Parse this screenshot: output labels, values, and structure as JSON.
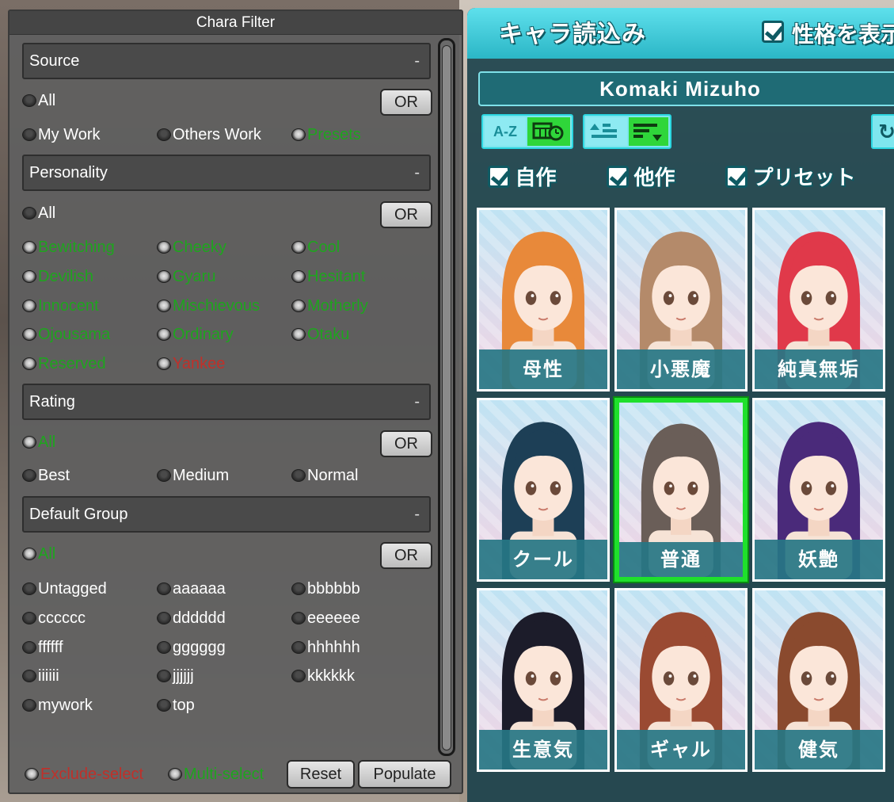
{
  "filter": {
    "title": "Chara Filter",
    "collapse_symbol": "-",
    "or_label": "OR",
    "source": {
      "header": "Source",
      "all": "All",
      "options": [
        {
          "label": "My Work",
          "selected": false,
          "color": "white"
        },
        {
          "label": "Others Work",
          "selected": false,
          "color": "white"
        },
        {
          "label": "Presets",
          "selected": true,
          "color": "green"
        }
      ]
    },
    "personality": {
      "header": "Personality",
      "all": "All",
      "options": [
        {
          "label": "Bewitching",
          "selected": true,
          "color": "green"
        },
        {
          "label": "Cheeky",
          "selected": true,
          "color": "green"
        },
        {
          "label": "Cool",
          "selected": true,
          "color": "green"
        },
        {
          "label": "Devilish",
          "selected": true,
          "color": "green"
        },
        {
          "label": "Gyaru",
          "selected": true,
          "color": "green"
        },
        {
          "label": "Hesitant",
          "selected": true,
          "color": "green"
        },
        {
          "label": "Innocent",
          "selected": true,
          "color": "green"
        },
        {
          "label": "Mischievous",
          "selected": true,
          "color": "green"
        },
        {
          "label": "Motherly",
          "selected": true,
          "color": "green"
        },
        {
          "label": "Ojousama",
          "selected": true,
          "color": "green"
        },
        {
          "label": "Ordinary",
          "selected": true,
          "color": "green"
        },
        {
          "label": "Otaku",
          "selected": true,
          "color": "green"
        },
        {
          "label": "Reserved",
          "selected": true,
          "color": "green"
        },
        {
          "label": "Yankee",
          "selected": true,
          "color": "red"
        }
      ]
    },
    "rating": {
      "header": "Rating",
      "all": "All",
      "options": [
        {
          "label": "Best",
          "selected": false,
          "color": "white"
        },
        {
          "label": "Medium",
          "selected": false,
          "color": "white"
        },
        {
          "label": "Normal",
          "selected": false,
          "color": "white"
        }
      ]
    },
    "default_group": {
      "header": "Default Group",
      "all": "All",
      "options": [
        {
          "label": "Untagged"
        },
        {
          "label": "aaaaaa"
        },
        {
          "label": "bbbbbb"
        },
        {
          "label": "cccccc"
        },
        {
          "label": "dddddd"
        },
        {
          "label": "eeeeee"
        },
        {
          "label": "ffffff"
        },
        {
          "label": "gggggg"
        },
        {
          "label": "hhhhhh"
        },
        {
          "label": "iiiiii"
        },
        {
          "label": "jjjjjj"
        },
        {
          "label": "kkkkkk"
        },
        {
          "label": "mywork"
        },
        {
          "label": "top"
        }
      ]
    },
    "footer": {
      "exclude_select": "Exclude-select",
      "multi_select": "Multi-select",
      "reset": "Reset",
      "populate": "Populate"
    },
    "colors": {
      "green": "#1ea51e",
      "red": "#c0302a"
    }
  },
  "chara": {
    "title": "キャラ読込み",
    "show_personality": "性格を表示",
    "name": "Komaki Mizuho",
    "sort_az": "A-Z",
    "sources": [
      "自作",
      "他作",
      "プリセット"
    ],
    "cards": [
      {
        "caption": "母性",
        "hair": "#e8893a",
        "selected": false
      },
      {
        "caption": "小悪魔",
        "hair": "#b48a6a",
        "selected": false
      },
      {
        "caption": "純真無垢",
        "hair": "#e0394a",
        "selected": false
      },
      {
        "caption": "クール",
        "hair": "#1d3f56",
        "selected": false
      },
      {
        "caption": "普通",
        "hair": "#6a5e58",
        "selected": true
      },
      {
        "caption": "妖艶",
        "hair": "#4a2a7a",
        "selected": false
      },
      {
        "caption": "生意気",
        "hair": "#1c1c2a",
        "selected": false
      },
      {
        "caption": "ギャル",
        "hair": "#9a4a32",
        "selected": false
      },
      {
        "caption": "健気",
        "hair": "#8a4a2e",
        "selected": false
      }
    ]
  }
}
